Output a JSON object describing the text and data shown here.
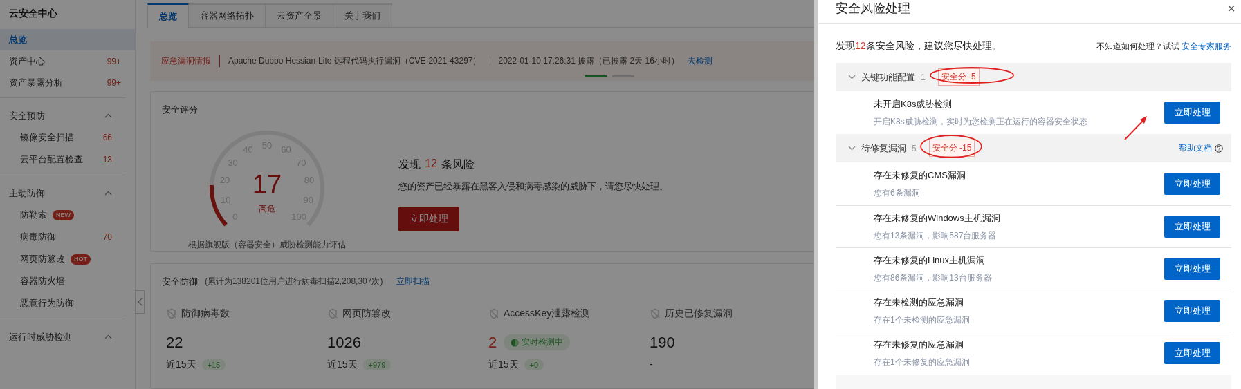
{
  "sidebar": {
    "title": "云安全中心",
    "groups": [
      {
        "items": [
          {
            "label": "总览",
            "selected": true
          },
          {
            "label": "资产中心",
            "count": "99+",
            "selected": false
          },
          {
            "label": "资产暴露分析",
            "count": "99+",
            "selected": false
          }
        ]
      },
      {
        "heading": "安全预防",
        "expanded": true,
        "items": [
          {
            "label": "镜像安全扫描",
            "count": "66",
            "selected": false
          },
          {
            "label": "云平台配置检查",
            "count": "13",
            "selected": false
          }
        ]
      },
      {
        "heading": "主动防御",
        "expanded": true,
        "items": [
          {
            "label": "防勒索",
            "badge": "NEW",
            "selected": false
          },
          {
            "label": "病毒防御",
            "count": "70",
            "selected": false
          },
          {
            "label": "网页防篡改",
            "badge": "HOT",
            "selected": false
          },
          {
            "label": "容器防火墙",
            "selected": false
          },
          {
            "label": "恶意行为防御",
            "selected": false
          }
        ]
      },
      {
        "heading": "运行时威胁检测",
        "expanded": true
      }
    ]
  },
  "tabs": [
    {
      "label": "总览",
      "selected": true
    },
    {
      "label": "容器网络拓扑",
      "selected": false
    },
    {
      "label": "云资产全景",
      "selected": false
    },
    {
      "label": "关于我们",
      "selected": false
    }
  ],
  "alert": {
    "label": "应急漏洞情报",
    "text": "Apache Dubbo Hessian-Lite 远程代码执行漏洞（CVE-2021-43297）",
    "time": "2022-01-10 17:26:31 披露（已披露 2天 16小时）",
    "link": "去检测",
    "pager": [
      {
        "selected": true
      },
      {
        "selected": false
      }
    ]
  },
  "score_card": {
    "title": "安全评分",
    "gauge": {
      "ticks": [
        "0",
        "10",
        "20",
        "30",
        "40",
        "50",
        "60",
        "70",
        "80",
        "90",
        "100"
      ],
      "score": "17",
      "rating": "高危",
      "level": 0.17
    },
    "caption": "根据旗舰版（容器安全）威胁检测能力评估",
    "headline": {
      "before": "发现",
      "count": "12",
      "after": "条风险"
    },
    "description": "您的资产已经暴露在黑客入侵和病毒感染的威胁下，请您尽快处理。",
    "button": "立即处理"
  },
  "defense_card": {
    "title": "安全防御",
    "note": "(累计为138201位用户进行病毒扫描2,208,307次)",
    "link": "立即扫描",
    "stats": [
      {
        "label": "防御病毒数",
        "value": "22",
        "alert": false,
        "period": "近15天",
        "delta": "+15"
      },
      {
        "label": "网页防篡改",
        "value": "1026",
        "alert": false,
        "period": "近15天",
        "delta": "+979"
      },
      {
        "label": "AccessKey泄露检测",
        "value": "2",
        "alert": true,
        "status": "实时检测中",
        "period": "近15天",
        "delta": "+0"
      },
      {
        "label": "历史已修复漏洞",
        "value": "190",
        "alert": false,
        "period": "-"
      }
    ]
  },
  "drawer": {
    "title": "安全风险处理",
    "close": "×",
    "summary": {
      "before": "发现",
      "count": "12",
      "after": "条安全风险，建议您尽快处理。"
    },
    "help": {
      "text": "不知道如何处理？试试",
      "link": "安全专家服务"
    },
    "groups": [
      {
        "title": "关键功能配置",
        "count": "1",
        "score": "安全分 -5",
        "expanded": true,
        "circled": true,
        "items": [
          {
            "title": "未开启K8s威胁检测",
            "description": "开启K8s威胁检测，实时为您检测正在运行的容器安全状态",
            "button": "立即处理",
            "marked": true
          }
        ]
      },
      {
        "title": "待修复漏洞",
        "count": "5",
        "score": "安全分 -15",
        "expanded": true,
        "circled": true,
        "help_link": "帮助文档",
        "items": [
          {
            "title": "存在未修复的CMS漏洞",
            "description": "您有6条漏洞",
            "button": "立即处理",
            "marked": false
          },
          {
            "title": "存在未修复的Windows主机漏洞",
            "description": "您有13条漏洞，影响587台服务器",
            "button": "立即处理",
            "marked": false
          },
          {
            "title": "存在未修复的Linux主机漏洞",
            "description": "您有86条漏洞，影响13台服务器",
            "button": "立即处理",
            "marked": false
          },
          {
            "title": "存在未检测的应急漏洞",
            "description": "存在1个未检测的应急漏洞",
            "button": "立即处理",
            "marked": false
          },
          {
            "title": "存在未修复的应急漏洞",
            "description": "存在1个未修复的应急漏洞",
            "button": "立即处理",
            "marked": false
          }
        ]
      }
    ]
  }
}
